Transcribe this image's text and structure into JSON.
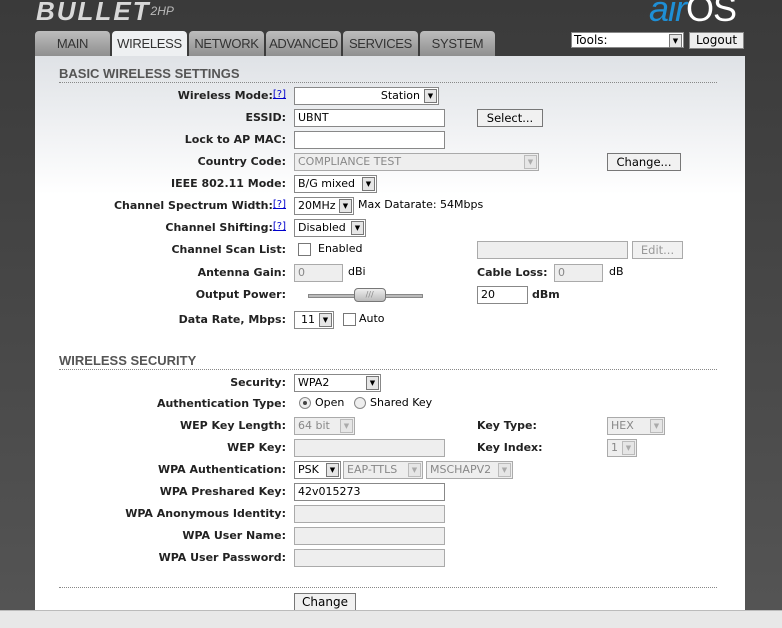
{
  "header": {
    "logo": "BULLET",
    "logo_model": "2HP",
    "brand_air": "air",
    "brand_os": "OS",
    "tools_label": "Tools:",
    "logout_label": "Logout"
  },
  "tabs": [
    "MAIN",
    "WIRELESS",
    "NETWORK",
    "ADVANCED",
    "SERVICES",
    "SYSTEM"
  ],
  "active_tab": "WIRELESS",
  "help_mark": "[?]",
  "basic": {
    "title": "BASIC WIRELESS SETTINGS",
    "wireless_mode": {
      "label": "Wireless Mode:",
      "value": "Station"
    },
    "essid": {
      "label": "ESSID:",
      "value": "UBNT",
      "button": "Select..."
    },
    "lock_ap": {
      "label": "Lock to AP MAC:",
      "value": ""
    },
    "country": {
      "label": "Country Code:",
      "value": "COMPLIANCE TEST",
      "button": "Change..."
    },
    "ieee_mode": {
      "label": "IEEE 802.11 Mode:",
      "value": "B/G mixed"
    },
    "spectrum": {
      "label": "Channel Spectrum Width:",
      "value": "20MHz",
      "note": "Max Datarate: 54Mbps"
    },
    "shifting": {
      "label": "Channel Shifting:",
      "value": "Disabled"
    },
    "scan_list": {
      "label": "Channel Scan List:",
      "checkbox": "Enabled",
      "value": "",
      "button": "Edit..."
    },
    "antenna": {
      "label": "Antenna Gain:",
      "value": "0",
      "unit": "dBi"
    },
    "cable": {
      "label": "Cable Loss:",
      "value": "0",
      "unit": "dB"
    },
    "output_power": {
      "label": "Output Power:",
      "value": "20",
      "unit": "dBm",
      "slider_fraction": 0.55
    },
    "data_rate": {
      "label": "Data Rate, Mbps:",
      "value": "11",
      "checkbox": "Auto"
    }
  },
  "security": {
    "title": "WIRELESS SECURITY",
    "security": {
      "label": "Security:",
      "value": "WPA2"
    },
    "auth_type": {
      "label": "Authentication Type:",
      "options": [
        "Open",
        "Shared Key"
      ],
      "selected": "Open"
    },
    "wep_len": {
      "label": "WEP Key Length:",
      "value": "64 bit"
    },
    "key_type": {
      "label": "Key Type:",
      "value": "HEX"
    },
    "wep_key": {
      "label": "WEP Key:",
      "value": ""
    },
    "key_index": {
      "label": "Key Index:",
      "value": "1"
    },
    "wpa_auth": {
      "label": "WPA Authentication:",
      "value": "PSK",
      "eap": "EAP-TTLS",
      "inner": "MSCHAPV2"
    },
    "psk": {
      "label": "WPA Preshared Key:",
      "value": "42v015273"
    },
    "anon": {
      "label": "WPA Anonymous Identity:",
      "value": ""
    },
    "user": {
      "label": "WPA User Name:",
      "value": ""
    },
    "pass": {
      "label": "WPA User Password:",
      "value": ""
    }
  },
  "change_button": "Change"
}
